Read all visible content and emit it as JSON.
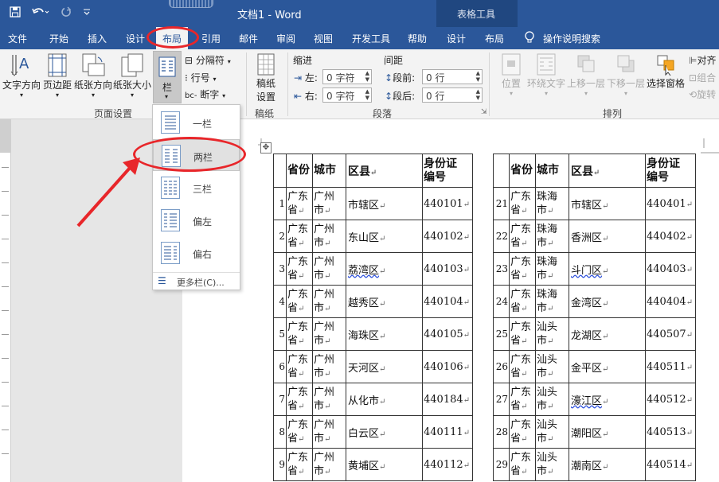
{
  "titlebar": {
    "doc_title": "文档1  -  Word",
    "context_title": "表格工具"
  },
  "tabs": [
    {
      "label": "文件"
    },
    {
      "label": "开始"
    },
    {
      "label": "插入"
    },
    {
      "label": "设计"
    },
    {
      "label": "布局"
    },
    {
      "label": "引用"
    },
    {
      "label": "邮件"
    },
    {
      "label": "审阅"
    },
    {
      "label": "视图"
    },
    {
      "label": "开发工具"
    },
    {
      "label": "帮助"
    },
    {
      "label": "设计"
    },
    {
      "label": "布局"
    },
    {
      "label": "操作说明搜索"
    }
  ],
  "ribbon": {
    "page_setup": {
      "text_direction": "文字方向",
      "margins": "页边距",
      "orientation": "纸张方向",
      "size": "纸张大小",
      "columns": "栏",
      "breaks": "分隔符",
      "line_numbers": "行号",
      "hyphenation": "断字",
      "group_label": "页面设置"
    },
    "draft": {
      "button": "稿纸\n设置",
      "button_l1": "稿纸",
      "button_l2": "设置",
      "group_label": "稿纸"
    },
    "paragraph": {
      "indent_title": "缩进",
      "spacing_title": "间距",
      "left_label": "左:",
      "left_value": "0 字符",
      "right_label": "右:",
      "right_value": "0 字符",
      "before_label": "段前:",
      "before_value": "0 行",
      "after_label": "段后:",
      "after_value": "0 行",
      "group_label": "段落"
    },
    "arrange": {
      "position": "位置",
      "wrap_text": "环绕文字",
      "bring_forward": "上移一层",
      "send_backward": "下移一层",
      "selection_pane": "选择窗格",
      "align": "对齐",
      "group": "组合",
      "rotate": "旋转",
      "group_label": "排列"
    }
  },
  "columns_menu": {
    "items": [
      "一栏",
      "两栏",
      "三栏",
      "偏左",
      "偏右"
    ],
    "more": "更多栏(C)..."
  },
  "table_left": {
    "header": {
      "province": "省份",
      "city": "城市",
      "district": "区县",
      "code_l1": "身份证",
      "code_l2": "编号"
    },
    "rows": [
      {
        "n": "1",
        "p1": "广东",
        "p2": "省",
        "c1": "广州",
        "c2": "市",
        "d": "市辖区",
        "code": "440101"
      },
      {
        "n": "2",
        "p1": "广东",
        "p2": "省",
        "c1": "广州",
        "c2": "市",
        "d": "东山区",
        "code": "440102"
      },
      {
        "n": "3",
        "p1": "广东",
        "p2": "省",
        "c1": "广州",
        "c2": "市",
        "d": "荔湾区",
        "code": "440103"
      },
      {
        "n": "4",
        "p1": "广东",
        "p2": "省",
        "c1": "广州",
        "c2": "市",
        "d": "越秀区",
        "code": "440104"
      },
      {
        "n": "5",
        "p1": "广东",
        "p2": "省",
        "c1": "广州",
        "c2": "市",
        "d": "海珠区",
        "code": "440105"
      },
      {
        "n": "6",
        "p1": "广东",
        "p2": "省",
        "c1": "广州",
        "c2": "市",
        "d": "天河区",
        "code": "440106"
      },
      {
        "n": "7",
        "p1": "广东",
        "p2": "省",
        "c1": "广州",
        "c2": "市",
        "d": "从化市",
        "code": "440184"
      },
      {
        "n": "8",
        "p1": "广东",
        "p2": "省",
        "c1": "广州",
        "c2": "市",
        "d": "白云区",
        "code": "440111"
      },
      {
        "n": "9",
        "p1": "广东",
        "p2": "省",
        "c1": "广州",
        "c2": "市",
        "d": "黄埔区",
        "code": "440112"
      }
    ]
  },
  "table_right": {
    "header": {
      "province": "省份",
      "city": "城市",
      "district": "区县",
      "code_l1": "身份证",
      "code_l2": "编号"
    },
    "rows": [
      {
        "n": "21",
        "p1": "广东",
        "p2": "省",
        "c1": "珠海",
        "c2": "市",
        "d": "市辖区",
        "code": "440401"
      },
      {
        "n": "22",
        "p1": "广东",
        "p2": "省",
        "c1": "珠海",
        "c2": "市",
        "d": "香洲区",
        "code": "440402"
      },
      {
        "n": "23",
        "p1": "广东",
        "p2": "省",
        "c1": "珠海",
        "c2": "市",
        "d": "斗门区",
        "code": "440403"
      },
      {
        "n": "24",
        "p1": "广东",
        "p2": "省",
        "c1": "珠海",
        "c2": "市",
        "d": "金湾区",
        "code": "440404"
      },
      {
        "n": "25",
        "p1": "广东",
        "p2": "省",
        "c1": "汕头",
        "c2": "市",
        "d": "龙湖区",
        "code": "440507"
      },
      {
        "n": "26",
        "p1": "广东",
        "p2": "省",
        "c1": "汕头",
        "c2": "市",
        "d": "金平区",
        "code": "440511"
      },
      {
        "n": "27",
        "p1": "广东",
        "p2": "省",
        "c1": "汕头",
        "c2": "市",
        "d": "濠江区",
        "code": "440512"
      },
      {
        "n": "28",
        "p1": "广东",
        "p2": "省",
        "c1": "汕头",
        "c2": "市",
        "d": "潮阳区",
        "code": "440513"
      },
      {
        "n": "29",
        "p1": "广东",
        "p2": "省",
        "c1": "汕头",
        "c2": "市",
        "d": "潮南区",
        "code": "440514"
      }
    ]
  },
  "colors": {
    "title_blue": "#2b579a",
    "context_blue": "#204780",
    "annotation_red": "#e8262a"
  }
}
